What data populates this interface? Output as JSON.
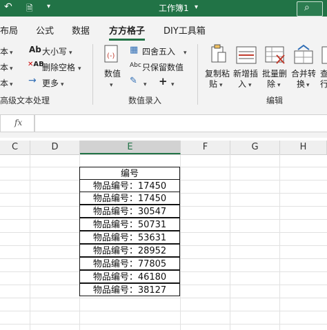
{
  "titlebar": {
    "quick_icon": "doc-icon",
    "title": "工作簿1",
    "title_arrow": "⌄",
    "search_glyph": "⌕"
  },
  "tabs": [
    {
      "label": "布局"
    },
    {
      "label": "公式"
    },
    {
      "label": "数据"
    },
    {
      "label": "方方格子",
      "active": true
    },
    {
      "label": "DIY工具箱"
    }
  ],
  "ribbon": {
    "left_items": [
      "本",
      "本",
      "本"
    ],
    "text_group": {
      "size_label": "大小写",
      "delete_space_label": "删除空格",
      "more_label": "更多",
      "group_label": "高级文本处理"
    },
    "numeric_group": {
      "numeric_label": "数值",
      "round_label": "四舍五入",
      "keep_digits_label": "只保留数值",
      "group_label": "数值录入"
    },
    "edit_group": {
      "copy_paste_label": "复制粘",
      "copy_paste_label2": "贴",
      "insert_label": "新增插",
      "insert_label2": "入",
      "batch_delete_label": "批量删",
      "batch_delete_label2": "除",
      "merge_label": "合并转",
      "merge_label2": "换",
      "more_label": "查",
      "more_label2": "行",
      "group_label": "编辑"
    }
  },
  "formula_bar": {
    "fx": "fx",
    "value": ""
  },
  "columns": [
    "C",
    "D",
    "E",
    "F",
    "G",
    "H"
  ],
  "selected_column": "E",
  "table": {
    "header": "编号",
    "rows": [
      "物品编号：17450",
      "物品编号：17450",
      "物品编号：30547",
      "物品编号：50731",
      "物品编号：53631",
      "物品编号：28952",
      "物品编号：77805",
      "物品编号：46180",
      "物品编号：38127"
    ]
  },
  "colors": {
    "accent": "#217346"
  }
}
